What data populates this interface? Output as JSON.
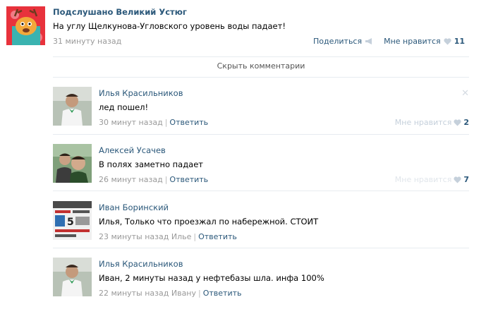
{
  "post": {
    "author": "Подслушано Великий Устюг",
    "text": "На углу Щелкунова-Угловского уровень воды падает!",
    "time": "31 минуту назад",
    "share_label": "Поделиться",
    "like_label": "Мне нравится",
    "like_count": "11"
  },
  "hide_comments_label": "Скрыть комментарии",
  "comments": [
    {
      "author": "Илья Красильников",
      "text": "лед пошел!",
      "time": "30 минут назад",
      "reply_label": "Ответить",
      "like_label": "Мне нравится",
      "like_count": "2"
    },
    {
      "author": "Алексей Усачев",
      "text": "В полях заметно падает",
      "time": "26 минут назад",
      "reply_label": "Ответить",
      "like_label": "Мне нравится",
      "like_count": "7"
    },
    {
      "author": "Иван Боринский",
      "text": "Илья, Только что проезжал по набережной. СТОИТ",
      "time": "23 минуты назад Илье",
      "reply_label": "Ответить"
    },
    {
      "author": "Илья Красильников",
      "text": "Иван, 2 минуты назад у нефтебазы шла. инфа 100%",
      "time": "22 минуты назад Ивану",
      "reply_label": "Ответить"
    }
  ],
  "colors": {
    "link": "#2b587a",
    "muted": "#999999",
    "divider": "#e7ebf0"
  },
  "icons": {
    "share": "megaphone-icon",
    "like": "heart-icon",
    "close": "close-icon"
  }
}
